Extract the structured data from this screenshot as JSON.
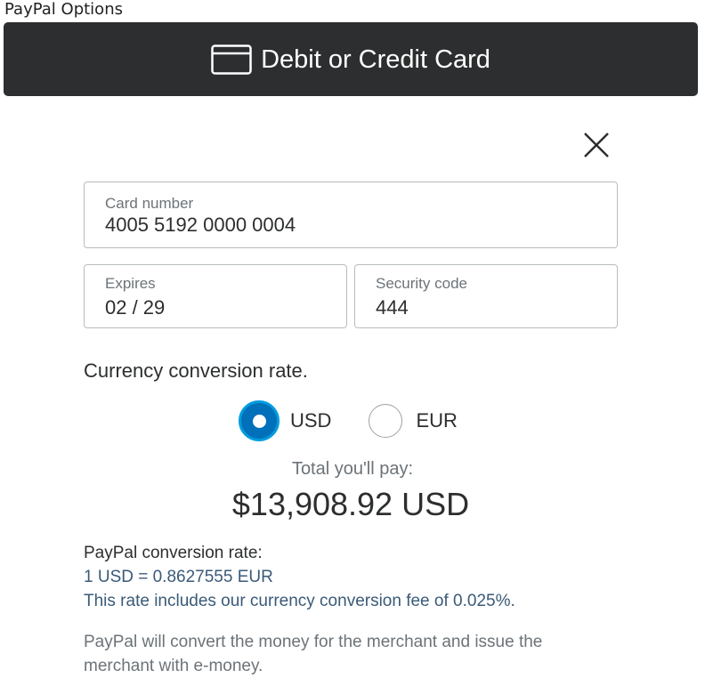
{
  "page": {
    "title": "PayPal Options"
  },
  "payment_method": {
    "label": "Debit or Credit Card",
    "icon": "credit-card-icon"
  },
  "close": {
    "icon": "close-icon"
  },
  "fields": {
    "card_number": {
      "label": "Card number",
      "value": "4005 5192 0000 0004"
    },
    "expires": {
      "label": "Expires",
      "value": "02 / 29"
    },
    "security_code": {
      "label": "Security code",
      "value": "444"
    }
  },
  "currency": {
    "title": "Currency conversion rate.",
    "options": [
      {
        "label": "USD",
        "selected": true
      },
      {
        "label": "EUR",
        "selected": false
      }
    ]
  },
  "total": {
    "label": "Total you'll pay:",
    "amount": "$13,908.92 USD"
  },
  "conversion": {
    "title": "PayPal conversion rate:",
    "rate": "1 USD = 0.8627555 EUR",
    "fee_note": "This rate includes our currency conversion fee of 0.025%.",
    "disclaimer": "PayPal will convert the money for the merchant and issue the merchant with e-money."
  },
  "colors": {
    "button_bg": "#2c2e2f",
    "radio_selected": "#0070ba",
    "radio_ring": "#009cde",
    "link_text": "#3a5a78"
  }
}
